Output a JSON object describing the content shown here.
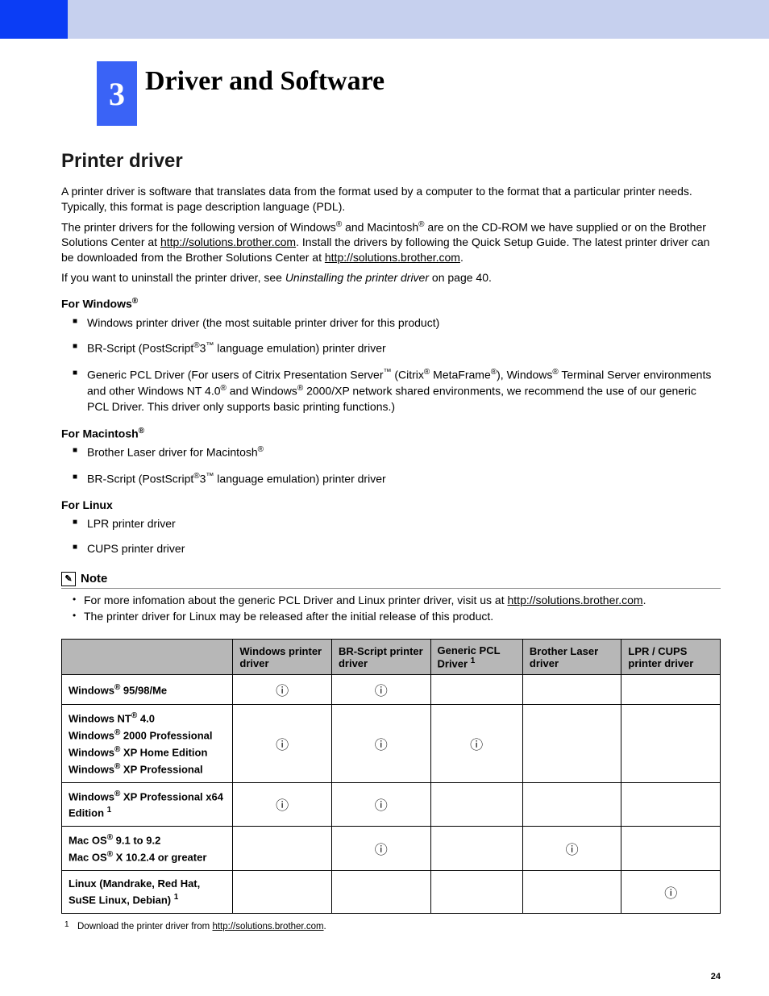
{
  "chapter": {
    "number": "3",
    "title": "Driver and Software"
  },
  "section_title": "Printer driver",
  "para1": "A printer driver is software that translates data from the format used by a computer to the format that a particular printer needs. Typically, this format is page description language (PDL).",
  "para2_a": "The printer drivers for the following version of Windows",
  "para2_b": " and Macintosh",
  "para2_c": " are on the CD-ROM we have supplied or on the Brother Solutions Center at ",
  "para2_link": "http://solutions.brother.com",
  "para2_d": ". Install the drivers by following the Quick Setup Guide. The latest printer driver can be downloaded from the Brother Solutions Center at ",
  "para2_link2": "http://solutions.brother.com",
  "para2_e": ".",
  "para3_a": "If you want to uninstall the printer driver, see ",
  "para3_ital": "Uninstalling the printer driver",
  "para3_b": " on page 40.",
  "windows_head_a": "For Windows",
  "win_li1": "Windows printer driver (the most suitable printer driver for this product)",
  "win_li2_a": "BR-Script (PostScript",
  "win_li2_b": "3",
  "win_li2_c": " language emulation) printer driver",
  "win_li3_a": "Generic PCL Driver (For users of Citrix Presentation Server",
  "win_li3_b": " (Citrix",
  "win_li3_c": " MetaFrame",
  "win_li3_d": "), Windows",
  "win_li3_e": " Terminal Server environments and other Windows NT 4.0",
  "win_li3_f": " and Windows",
  "win_li3_g": " 2000/XP network shared environments, we recommend the use of our generic PCL Driver. This driver only supports basic printing functions.)",
  "mac_head_a": "For Macintosh",
  "mac_li1_a": "Brother Laser driver for Macintosh",
  "mac_li2_a": "BR-Script (PostScript",
  "mac_li2_b": "3",
  "mac_li2_c": " language emulation) printer driver",
  "linux_head": "For Linux",
  "linux_li1": "LPR printer driver",
  "linux_li2": "CUPS printer driver",
  "note_label": "Note",
  "note_li1_a": "For more infomation about the generic PCL Driver and Linux printer driver, visit us at ",
  "note_li1_link": "http://solutions.brother.com",
  "note_li1_b": ".",
  "note_li2": "The printer driver for Linux may be released after the initial release of this product.",
  "table": {
    "headers": [
      "",
      "Windows printer driver",
      "BR-Script printer driver",
      "Generic PCL Driver ",
      "Brother Laser driver",
      "LPR / CUPS printer driver"
    ],
    "header_foot": "1",
    "rows": [
      {
        "label_parts": [
          "Windows",
          " 95/98/Me"
        ],
        "sups": [
          "®"
        ],
        "cells": [
          "i",
          "i",
          "",
          "",
          ""
        ]
      },
      {
        "label_lines": [
          {
            "a": "Windows NT",
            "s": "®",
            "b": " 4.0"
          },
          {
            "a": "Windows",
            "s": "®",
            "b": " 2000 Professional"
          },
          {
            "a": "Windows",
            "s": "®",
            "b": " XP Home Edition"
          },
          {
            "a": "Windows",
            "s": "®",
            "b": " XP Professional"
          }
        ],
        "cells": [
          "i",
          "i",
          "i",
          "",
          ""
        ]
      },
      {
        "label_lines": [
          {
            "a": "Windows",
            "s": "®",
            "b": " XP Professional x64 Edition ",
            "fn": "1"
          }
        ],
        "cells": [
          "i",
          "i",
          "",
          "",
          ""
        ]
      },
      {
        "label_lines": [
          {
            "a": "Mac OS",
            "s": "®",
            "b": " 9.1 to 9.2"
          },
          {
            "a": "Mac OS",
            "s": "®",
            "b": " X 10.2.4 or greater"
          }
        ],
        "cells": [
          "",
          "i",
          "",
          "i",
          ""
        ]
      },
      {
        "label_lines": [
          {
            "a": "Linux (Mandrake, Red Hat, SuSE Linux, Debian) ",
            "fn": "1"
          }
        ],
        "cells": [
          "",
          "",
          "",
          "",
          "i"
        ]
      }
    ]
  },
  "footnote_num": "1",
  "footnote_a": "Download the printer driver  from ",
  "footnote_link": "http://solutions.brother.com",
  "footnote_b": ".",
  "page_number": "24",
  "reg": "®",
  "tm": "™",
  "circle_i": "ⓘ"
}
